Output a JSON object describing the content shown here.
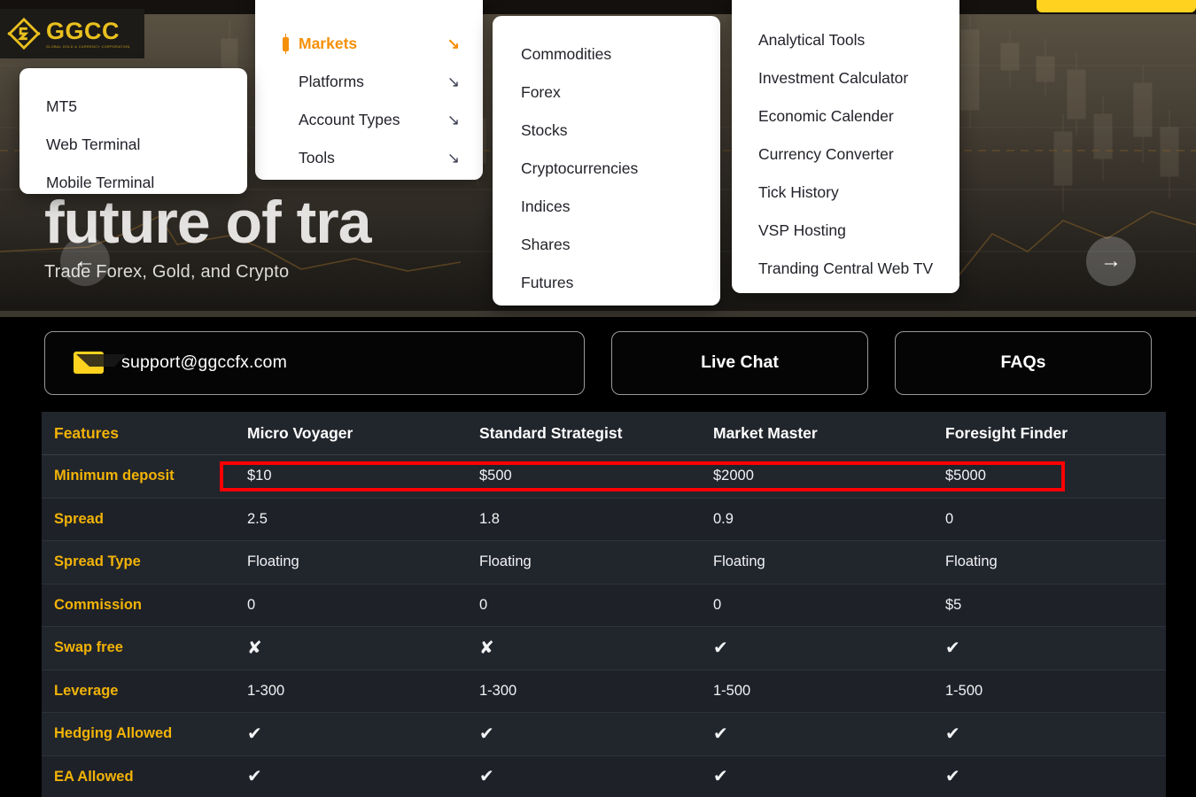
{
  "brand": {
    "logo_text": "GGCC",
    "logo_tagline": "GLOBAL GOLD & CURRENCY CORPORATION",
    "accent_yellow": "#FFD21F",
    "accent_orange": "#F59009",
    "accent_gold": "#F2B307",
    "highlight_red": "#FF0000"
  },
  "hero": {
    "title": "future of tra",
    "subtitle": "Trade Forex, Gold, and Crypto",
    "prev_label": "←",
    "next_label": "→"
  },
  "nav_panel": {
    "items": [
      {
        "label": "Markets",
        "arrow": "↘",
        "active": true
      },
      {
        "label": "Platforms",
        "arrow": "↘",
        "active": false
      },
      {
        "label": "Account Types",
        "arrow": "↘",
        "active": false
      },
      {
        "label": "Tools",
        "arrow": "↘",
        "active": false
      }
    ]
  },
  "platforms_panel": {
    "items": [
      {
        "label": "MT5"
      },
      {
        "label": "Web Terminal"
      },
      {
        "label": "Mobile Terminal"
      }
    ]
  },
  "markets_panel": {
    "items": [
      {
        "label": "Commodities"
      },
      {
        "label": "Forex"
      },
      {
        "label": "Stocks"
      },
      {
        "label": "Cryptocurrencies"
      },
      {
        "label": "Indices"
      },
      {
        "label": "Shares"
      },
      {
        "label": "Futures"
      }
    ]
  },
  "tools_panel": {
    "items": [
      {
        "label": "Analytical Tools"
      },
      {
        "label": "Investment Calculator"
      },
      {
        "label": "Economic Calender"
      },
      {
        "label": "Currency Converter"
      },
      {
        "label": "Tick History"
      },
      {
        "label": "VSP Hosting"
      },
      {
        "label": "Tranding Central Web TV"
      }
    ]
  },
  "contact": {
    "email": "support@ggccfx.com",
    "live_chat": "Live Chat",
    "faqs": "FAQs"
  },
  "comparison": {
    "headers": [
      "Features",
      "Micro Voyager",
      "Standard Strategist",
      "Market Master",
      "Foresight Finder"
    ],
    "rows": [
      {
        "feature": "Minimum deposit",
        "values": [
          "$10",
          "$500",
          "$2000",
          "$5000"
        ],
        "highlighted": true
      },
      {
        "feature": "Spread",
        "values": [
          "2.5",
          "1.8",
          "0.9",
          "0"
        ],
        "highlighted": false
      },
      {
        "feature": "Spread Type",
        "values": [
          "Floating",
          "Floating",
          "Floating",
          "Floating"
        ],
        "highlighted": false
      },
      {
        "feature": "Commission",
        "values": [
          "0",
          "0",
          "0",
          "$5"
        ],
        "highlighted": false
      },
      {
        "feature": "Swap free",
        "values": [
          "✘",
          "✘",
          "✔",
          "✔"
        ],
        "highlighted": false
      },
      {
        "feature": "Leverage",
        "values": [
          "1-300",
          "1-300",
          "1-500",
          "1-500"
        ],
        "highlighted": false
      },
      {
        "feature": "Hedging Allowed",
        "values": [
          "✔",
          "✔",
          "✔",
          "✔"
        ],
        "highlighted": false
      },
      {
        "feature": "EA Allowed",
        "values": [
          "✔",
          "✔",
          "✔",
          "✔"
        ],
        "highlighted": false
      }
    ]
  }
}
